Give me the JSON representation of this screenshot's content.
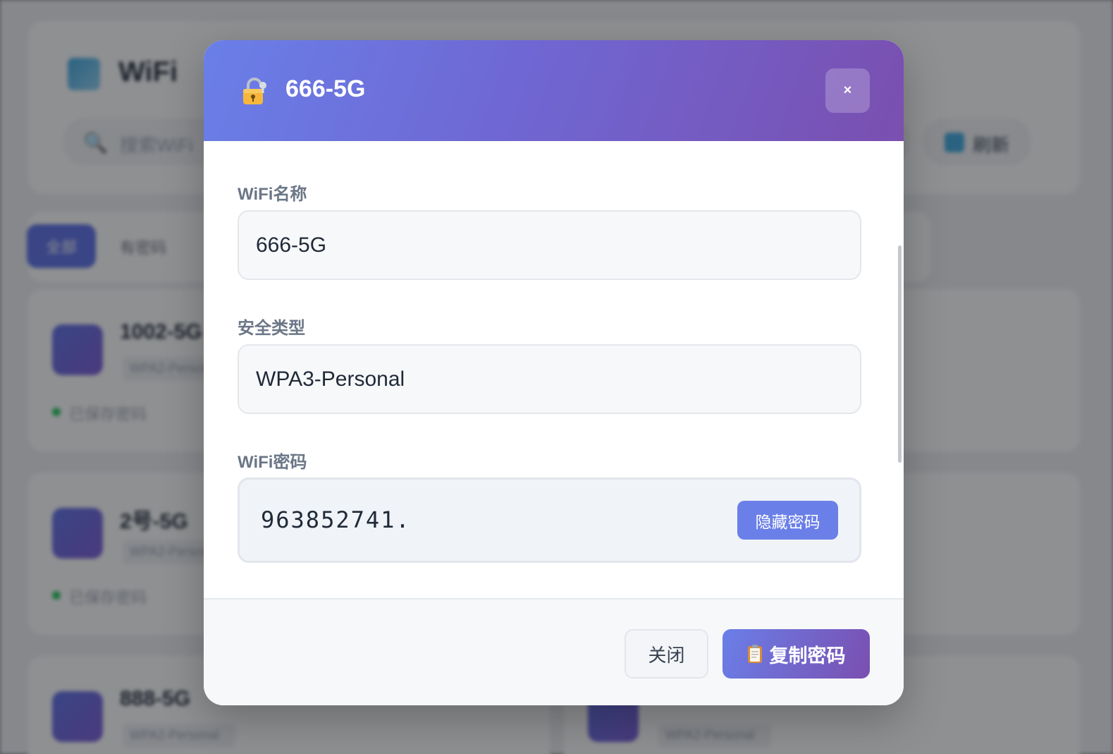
{
  "background": {
    "app_title": "WiFi",
    "search_placeholder": "搜索WiFi",
    "refresh_label": "刷新",
    "tabs": [
      {
        "label": "全部"
      },
      {
        "label": "有密码"
      }
    ],
    "cards": [
      {
        "name": "1002-5G",
        "security": "WPA2-Personal",
        "status": "已保存密码"
      },
      {
        "name": "2号-5G",
        "security": "WPA2-Personal",
        "status": "已保存密码"
      },
      {
        "name": "888-5G",
        "security": "WPA2-Personal",
        "status": ""
      },
      {
        "name": "",
        "security": "WPA2-Personal",
        "status": ""
      }
    ]
  },
  "modal": {
    "title": "666-5G",
    "close_symbol": "×",
    "lock_icon": "lock-icon",
    "fields": {
      "name_label": "WiFi名称",
      "name_value": "666-5G",
      "security_label": "安全类型",
      "security_value": "WPA3-Personal",
      "password_label": "WiFi密码",
      "password_value": "963852741.",
      "toggle_label": "隐藏密码"
    },
    "footer": {
      "close_label": "关闭",
      "copy_label": "复制密码",
      "copy_icon": "clipboard-icon"
    }
  },
  "colors": {
    "header_gradient_start": "#6a7fe8",
    "header_gradient_end": "#7a4fb0",
    "accent": "#6a7fe8",
    "status_green": "#22c55e"
  }
}
